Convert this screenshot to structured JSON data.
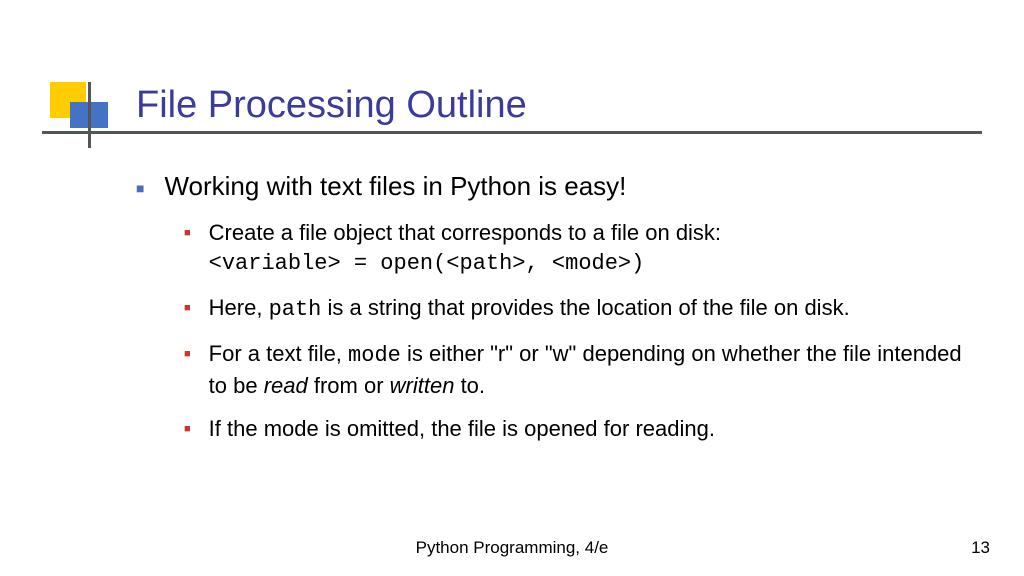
{
  "title": "File Processing Outline",
  "main_bullet": "Working with text files in Python is easy!",
  "sub": {
    "b1_line1": "Create a file object that corresponds to a file on disk:",
    "b1_code": "<variable> = open(<path>, <mode>)",
    "b2_pre": "Here, ",
    "b2_code": "path",
    "b2_post": " is a string that provides the location of the file on disk.",
    "b3_pre": "For a text file, ",
    "b3_code": "mode",
    "b3_mid": " is either \"r\" or \"w\" depending on whether the file intended to be ",
    "b3_em1": "read",
    "b3_mid2": " from or ",
    "b3_em2": "written",
    "b3_post": " to.",
    "b4": "If the mode is omitted, the file is opened for reading."
  },
  "footer": "Python Programming, 4/e",
  "page": "13"
}
